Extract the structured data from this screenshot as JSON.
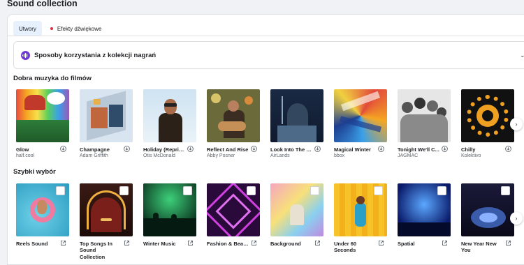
{
  "page": {
    "title": "Sound collection"
  },
  "tabs": [
    {
      "label": "Utwory",
      "active": true
    },
    {
      "label": "Efekty dźwiękowe",
      "active": false
    }
  ],
  "accordion": {
    "title": "Sposoby korzystania z kolekcji nagrań",
    "icon": "sound-wave-icon"
  },
  "sections": {
    "films": {
      "title": "Dobra muzyka do filmów",
      "items": [
        {
          "title": "Glow",
          "artist": "half.cool"
        },
        {
          "title": "Champagne",
          "artist": "Adam Griffith"
        },
        {
          "title": "Holiday (Reprise)",
          "artist": "Otis McDonald"
        },
        {
          "title": "Reflect And Rise",
          "artist": "Abby Posner"
        },
        {
          "title": "Look Into The D...",
          "artist": "AirLands"
        },
        {
          "title": "Magical Winter",
          "artist": "bbox"
        },
        {
          "title": "Tonight We'll C...",
          "artist": "JAGMAC"
        },
        {
          "title": "Chilly",
          "artist": "Kolektivo"
        }
      ]
    },
    "quick": {
      "title": "Szybki wybór",
      "items": [
        {
          "title": "Reels Sound"
        },
        {
          "title": "Top Songs In Sound Collection"
        },
        {
          "title": "Winter Music"
        },
        {
          "title": "Fashion & Beauty"
        },
        {
          "title": "Background"
        },
        {
          "title": "Under 60 Seconds"
        },
        {
          "title": "Spatial"
        },
        {
          "title": "New Year New You"
        }
      ]
    }
  },
  "colors": {
    "accent": "#6d3ad6",
    "tab_active_bg": "#e7f0fd",
    "dot": "#e02b3a"
  }
}
